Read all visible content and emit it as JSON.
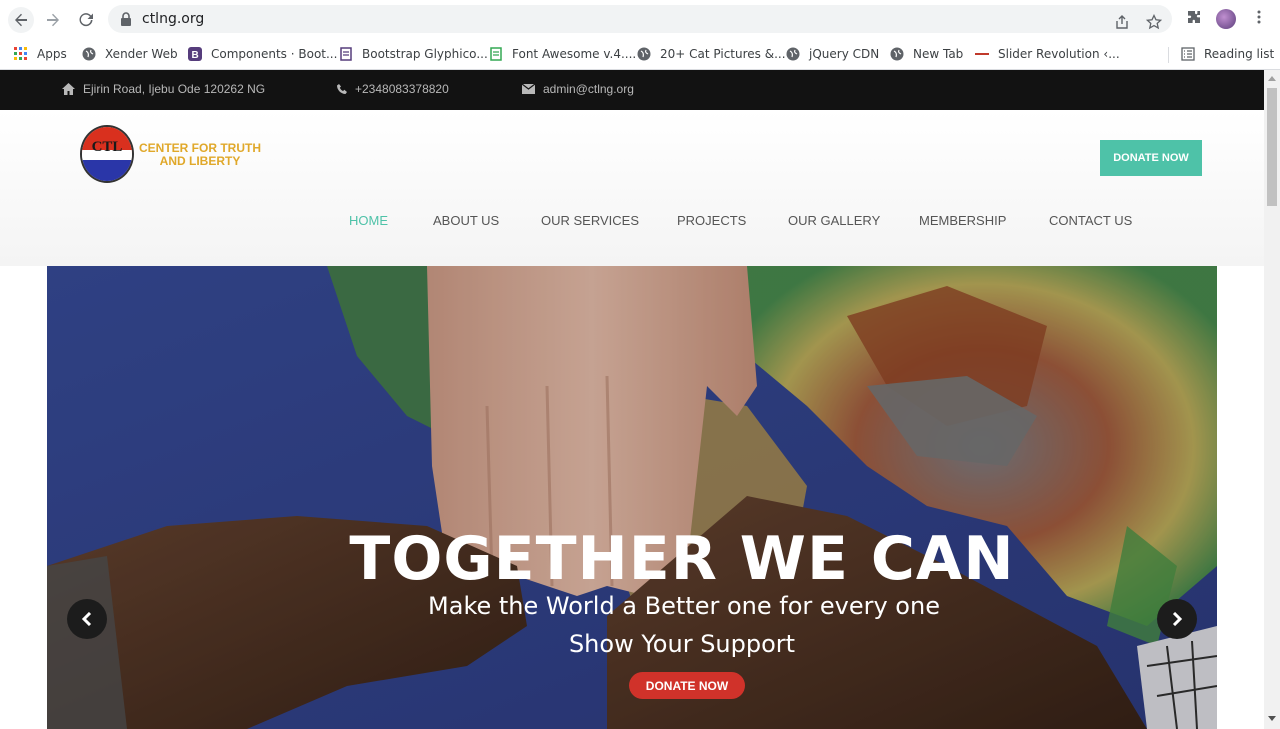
{
  "browser": {
    "url": "ctlng.org",
    "bookmarks": [
      {
        "label": "Apps",
        "icon": "apps-grid-icon"
      },
      {
        "label": "Xender Web",
        "icon": "globe-icon"
      },
      {
        "label": "Components · Boot...",
        "icon": "bootstrap-icon"
      },
      {
        "label": "Bootstrap Glyphico...",
        "icon": "page-icon"
      },
      {
        "label": "Font Awesome v.4....",
        "icon": "sheet-icon"
      },
      {
        "label": "20+ Cat Pictures &...",
        "icon": "globe-icon"
      },
      {
        "label": "jQuery CDN",
        "icon": "globe-icon"
      },
      {
        "label": "New Tab",
        "icon": "globe-icon"
      },
      {
        "label": "Slider Revolution ‹...",
        "icon": "slider-icon"
      }
    ],
    "reading_list": "Reading list"
  },
  "topbar": {
    "address": "Ejirin Road, Ijebu Ode 120262 NG",
    "phone": "+2348083378820",
    "email": "admin@ctlng.org"
  },
  "header": {
    "logo_text": "CTL",
    "org_name_line1": "CENTER FOR TRUTH",
    "org_name_line2": "AND LIBERTY",
    "donate_label": "DONATE NOW"
  },
  "nav": [
    "HOME",
    "ABOUT US",
    "OUR SERVICES",
    "PROJECTS",
    "OUR GALLERY",
    "MEMBERSHIP",
    "CONTACT US"
  ],
  "hero": {
    "title": "TOGETHER WE CAN",
    "subtitle": "Make the World a Better one for every one",
    "tagline": "Show Your Support",
    "donate_label": "DONATE NOW"
  },
  "colors": {
    "accent": "#4ec2a8",
    "donate_red": "#d0322a",
    "logo_gold": "#e0a82a",
    "topbar_bg": "#121212"
  }
}
